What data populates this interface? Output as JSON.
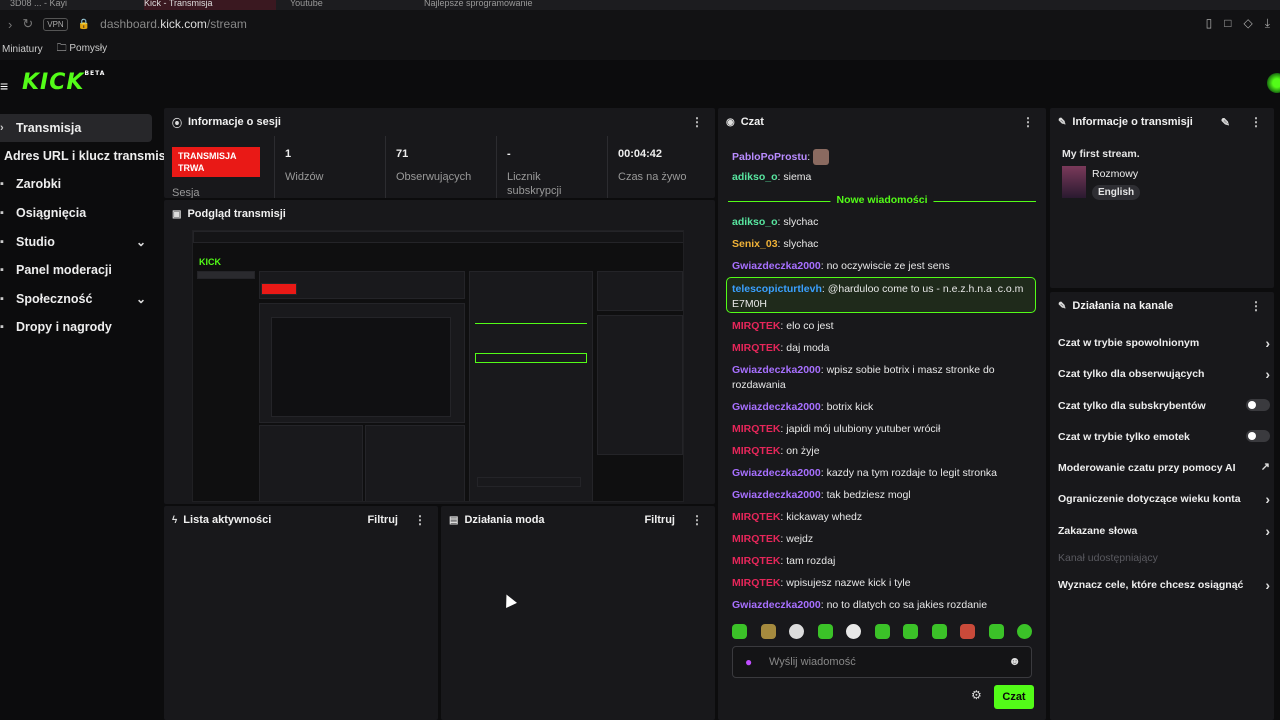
{
  "browser": {
    "tabs": [
      "3D08 ... - Kayi",
      "Kick - Transmisja",
      "Youtube",
      "Najlepsze sprogramowanie"
    ],
    "vpn_label": "VPN",
    "url_prefix": "dashboard.",
    "url_domain": "kick.com",
    "url_path": "/stream",
    "bookmarks": [
      "Miniatury",
      "Pomysły"
    ]
  },
  "brand": {
    "logo": "KICK",
    "beta": "BETA",
    "accent": "#53fc18"
  },
  "sidebar": {
    "items": [
      {
        "label": "Transmisja",
        "icon": "chevron-right-icon",
        "active": true
      },
      {
        "label": "Adres URL i klucz transmisji",
        "icon": "",
        "active": false
      },
      {
        "label": "Zarobki",
        "icon": "wallet-icon",
        "active": false
      },
      {
        "label": "Osiągnięcia",
        "icon": "trophy-icon",
        "active": false
      },
      {
        "label": "Studio",
        "icon": "studio-icon",
        "active": false,
        "expandable": true
      },
      {
        "label": "Panel moderacji",
        "icon": "shield-icon",
        "active": false
      },
      {
        "label": "Społeczność",
        "icon": "people-icon",
        "active": false,
        "expandable": true
      },
      {
        "label": "Dropy i nagrody",
        "icon": "gift-icon",
        "active": false
      }
    ]
  },
  "session": {
    "title": "Informacje o sesji",
    "live_badge": "TRANSMISJA TRWA",
    "session_label": "Sesja",
    "stats": [
      {
        "value": "1",
        "label": "Widzów"
      },
      {
        "value": "71",
        "label": "Obserwujących"
      },
      {
        "value": "-",
        "label": "Licznik subskrypcji"
      },
      {
        "value": "00:04:42",
        "label": "Czas na żywo"
      }
    ]
  },
  "preview": {
    "title": "Podgląd transmisji"
  },
  "activity": {
    "title": "Lista aktywności",
    "filter": "Filtruj"
  },
  "mod_actions": {
    "title": "Działania moda",
    "filter": "Filtruj"
  },
  "chat": {
    "title": "Czat",
    "new_messages": "Nowe wiadomości",
    "messages_before": [
      {
        "user": "PabloPoProstu",
        "text": "",
        "color": "u-blue"
      },
      {
        "user": "adikso_o",
        "text": "siema",
        "color": "u-green"
      }
    ],
    "messages": [
      {
        "user": "adikso_o",
        "text": "slychac",
        "color": "u-green"
      },
      {
        "user": "Senix_03",
        "text": "slychac",
        "color": "u-yellow"
      },
      {
        "user": "Gwiazdeczka2000",
        "text": "no oczywiscie ze jest sens",
        "color": "u-purple"
      },
      {
        "user": "telescopicturtlevh",
        "text": "@harduloo come to us - n.e.z.h.n.a .c.o.m",
        "text2": "E7M0H",
        "color": "u-cyan",
        "highlight": true
      },
      {
        "user": "MIRQTEK",
        "text": "elo co jest",
        "color": "u-red"
      },
      {
        "user": "MIRQTEK",
        "text": "daj moda",
        "color": "u-red"
      },
      {
        "user": "Gwiazdeczka2000",
        "text": "wpisz sobie botrix i masz stronke do",
        "text2": "rozdawania",
        "color": "u-purple"
      },
      {
        "user": "Gwiazdeczka2000",
        "text": "botrix kick",
        "color": "u-purple"
      },
      {
        "user": "MIRQTEK",
        "text": "japidi mój ulubiony yutuber wrócił",
        "color": "u-red"
      },
      {
        "user": "MIRQTEK",
        "text": "on żyje",
        "color": "u-red"
      },
      {
        "user": "Gwiazdeczka2000",
        "text": "kazdy na tym rozdaje to legit stronka",
        "color": "u-purple"
      },
      {
        "user": "Gwiazdeczka2000",
        "text": "tak bedziesz mogl",
        "color": "u-purple"
      },
      {
        "user": "MIRQTEK",
        "text": "kickaway whedz",
        "color": "u-red"
      },
      {
        "user": "MIRQTEK",
        "text": "wejdz",
        "color": "u-red"
      },
      {
        "user": "MIRQTEK",
        "text": "tam rozdaj",
        "color": "u-red"
      },
      {
        "user": "MIRQTEK",
        "text": "wpisujesz nazwe kick i tyle",
        "color": "u-red"
      },
      {
        "user": "Gwiazdeczka2000",
        "text": "no to dlatych co sa jakies rozdanie",
        "color": "u-purple"
      }
    ],
    "input_placeholder": "Wyślij wiadomość",
    "send_label": "Czat"
  },
  "stream_info": {
    "title": "Informacje o transmisji",
    "stream_title": "My first stream.",
    "category": "Rozmowy",
    "language": "English"
  },
  "channel_actions": {
    "title": "Działania na kanale",
    "items": [
      {
        "label": "Czat w trybie spowolnionym",
        "control": "arrow"
      },
      {
        "label": "Czat tylko dla obserwujących",
        "control": "arrow"
      },
      {
        "label": "Czat tylko dla subskrybentów",
        "control": "toggle"
      },
      {
        "label": "Czat w trybie tylko emotek",
        "control": "toggle"
      },
      {
        "label": "Moderowanie czatu przy pomocy AI",
        "control": "external"
      },
      {
        "label": "Ograniczenie dotyczące wieku konta",
        "control": "arrow"
      },
      {
        "label": "Zakazane słowa",
        "control": "arrow"
      },
      {
        "label": "Kanał udostępniający",
        "control": "none",
        "muted": true
      },
      {
        "label": "Wyznacz cele, które chcesz osiągnąć",
        "control": "arrow"
      }
    ]
  }
}
